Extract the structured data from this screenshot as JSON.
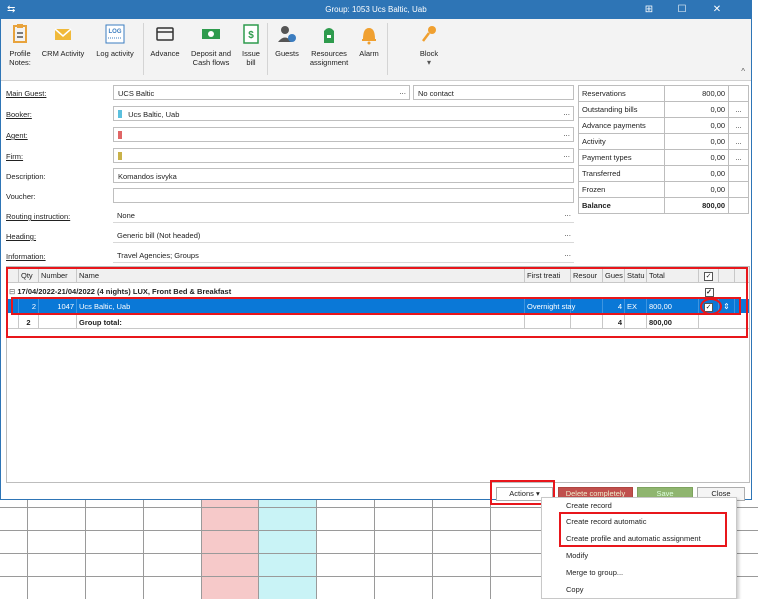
{
  "window": {
    "title": "Group: 1053 Ucs Baltic, Uab"
  },
  "ribbon": {
    "buttons": [
      {
        "label": "Profile\nNotes:",
        "icon": "profile-notes-icon"
      },
      {
        "label": "CRM Activity",
        "icon": "envelope-icon"
      },
      {
        "label": "Log activity",
        "icon": "log-icon",
        "icon_text": "LOG"
      },
      {
        "label": "Advance",
        "icon": "advance-icon"
      },
      {
        "label": "Deposit and\nCash flows",
        "icon": "cash-icon"
      },
      {
        "label": "Issue\nbill",
        "icon": "bill-icon"
      },
      {
        "label": "Guests",
        "icon": "guests-icon"
      },
      {
        "label": "Resources\nassignment",
        "icon": "resources-icon"
      },
      {
        "label": "Alarm",
        "icon": "alarm-icon"
      },
      {
        "label": "Block",
        "icon": "key-icon"
      }
    ]
  },
  "form": {
    "main_guest": {
      "label": "Main Guest:",
      "value": "UCS Baltic",
      "contact": "No contact"
    },
    "booker": {
      "label": "Booker:",
      "value": "Ucs Baltic, Uab"
    },
    "agent": {
      "label": "Agent:",
      "value": ""
    },
    "firm": {
      "label": "Firm:",
      "value": ""
    },
    "description": {
      "label": "Description:",
      "value": "Komandos isvyka"
    },
    "voucher": {
      "label": "Voucher:",
      "value": ""
    },
    "routing": {
      "label": "Routing instruction:",
      "value": "None"
    },
    "heading": {
      "label": "Heading:",
      "value": "Generic bill (Not headed)"
    },
    "information": {
      "label": "Information:",
      "value": "Travel Agencies; Groups"
    },
    "colors": {
      "booker": "#5bc0de",
      "agent": "#e06666",
      "firm": "#c9b24a"
    }
  },
  "summary": [
    {
      "name": "Reservations",
      "value": "800,00",
      "btn": ""
    },
    {
      "name": "Outstanding bills",
      "value": "0,00",
      "btn": "..."
    },
    {
      "name": "Advance payments",
      "value": "0,00",
      "btn": "..."
    },
    {
      "name": "Activity",
      "value": "0,00",
      "btn": "..."
    },
    {
      "name": "Payment types",
      "value": "0,00",
      "btn": "..."
    },
    {
      "name": "Transferred",
      "value": "0,00",
      "btn": ""
    },
    {
      "name": "Frozen",
      "value": "0,00",
      "btn": ""
    },
    {
      "name": "Balance",
      "value": "800,00",
      "btn": ""
    }
  ],
  "grid": {
    "headers": {
      "qty": "Qty",
      "number": "Number",
      "name": "Name",
      "first": "First treati",
      "resource": "Resour",
      "guests": "Gues",
      "status": "Statu",
      "total": "Total"
    },
    "group_row": "17/04/2022-21/04/2022 (4 nights) LUX, Front Bed & Breakfast",
    "row": {
      "qty": "2",
      "number": "1047",
      "name": "Ucs Baltic, Uab",
      "first": "Overnight stay",
      "guests": "4",
      "status": "EX",
      "total": "800,00"
    },
    "total_row": {
      "qty": "2",
      "label": "Group total:",
      "guests": "4",
      "total": "800,00"
    }
  },
  "buttons": {
    "actions": "Actions",
    "delete": "Delete completely",
    "save": "Save",
    "close": "Close"
  },
  "menu": [
    "Create record",
    "Create record automatic",
    "Create profile and automatic assignment",
    "Modify",
    "Merge to group...",
    "Copy"
  ],
  "symbols": {
    "dots": "...",
    "check": "✓",
    "caret": "▾",
    "collapse": "^",
    "expand": "⊟",
    "app": "⇆",
    "restore": "⊞",
    "minimize": "☐",
    "close": "✕"
  }
}
